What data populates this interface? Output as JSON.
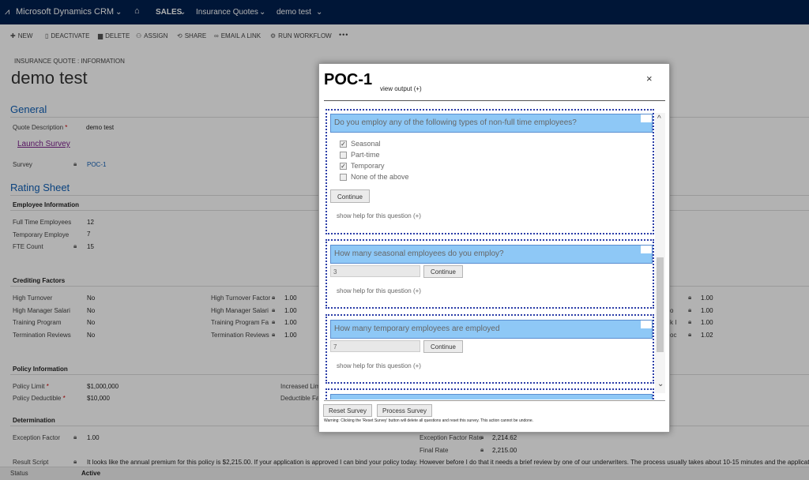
{
  "topnav": {
    "app_title": "Microsoft Dynamics CRM",
    "area": "SALES",
    "entity": "Insurance Quotes",
    "record": "demo test"
  },
  "commands": {
    "new": "NEW",
    "deactivate": "DEACTIVATE",
    "delete": "DELETE",
    "assign": "ASSIGN",
    "share": "SHARE",
    "email_link": "EMAIL A LINK",
    "run_workflow": "RUN WORKFLOW",
    "more": "•••"
  },
  "form": {
    "entity_label": "INSURANCE QUOTE : INFORMATION",
    "record_title": "demo test",
    "general": {
      "heading": "General",
      "quote_desc_label": "Quote Description",
      "quote_desc_required": "*",
      "quote_desc_value": "demo test",
      "launch_survey": "Launch Survey",
      "survey_label": "Survey",
      "survey_value": "POC-1"
    },
    "rating": {
      "heading": "Rating Sheet",
      "employee_info": "Employee Information",
      "fte_label": "Full Time Employees",
      "fte_value": "12",
      "temp_label": "Temporary Employe",
      "temp_value": "7",
      "fte_count_label": "FTE Count",
      "fte_count_value": "15"
    },
    "crediting": {
      "heading": "Crediting Factors",
      "left": [
        {
          "label": "High Turnover",
          "value": "No"
        },
        {
          "label": "High Manager Salari",
          "value": "No"
        },
        {
          "label": "Training Program",
          "value": "No"
        },
        {
          "label": "Termination Reviews",
          "value": "No"
        }
      ],
      "mid": [
        {
          "label": "High Turnover Factor",
          "value": "1.00"
        },
        {
          "label": "High Manager Salari",
          "value": "1.00"
        },
        {
          "label": "Training Program Fa",
          "value": "1.00"
        },
        {
          "label": "Termination Reviews",
          "value": "1.00"
        }
      ],
      "right_labels": [
        "",
        "o",
        "k I",
        "oc"
      ],
      "right": [
        "1.00",
        "1.00",
        "1.00",
        "1.02"
      ]
    },
    "policy": {
      "heading": "Policy Information",
      "limit_label": "Policy Limit",
      "limit_required": "*",
      "limit_value": "$1,000,000",
      "deductible_label": "Policy Deductible",
      "deductible_required": "*",
      "deductible_value": "$10,000",
      "increased_label": "Increased Lim",
      "deductible_fa_label": "Deductible Fa"
    },
    "determination": {
      "heading": "Determination",
      "exception_label": "Exception Factor",
      "exception_value": "1.00",
      "exception_rate_label": "Exception Factor Rate",
      "exception_rate_value": "2,214.62",
      "final_rate_label": "Final Rate",
      "final_rate_value": "2,215.00",
      "result_label": "Result Script",
      "result_text": "It looks like the annual premium for this policy is $2,215.00. If your application is approved I can bind your policy today. However before I do that it needs a brief review by one of our underwriters. The process usually takes about 10-15 minutes and the application is"
    }
  },
  "status": {
    "label": "Status",
    "value": "Active"
  },
  "dialog": {
    "title": "POC-1",
    "view_output": "view output (+)",
    "close": "×",
    "q1": {
      "question": "Do you employ any of the following types of non-full time employees?",
      "options": [
        {
          "label": "Seasonal",
          "checked": true
        },
        {
          "label": "Part-time",
          "checked": false
        },
        {
          "label": "Temporary",
          "checked": true
        },
        {
          "label": "None of the above",
          "checked": false
        }
      ],
      "continue": "Continue",
      "help": "show help for this question (+)"
    },
    "q2": {
      "question": "How many seasonal employees do you employ?",
      "value": "3",
      "continue": "Continue",
      "help": "show help for this question (+)"
    },
    "q3": {
      "question": "How many temporary employees are employed",
      "value": "7",
      "continue": "Continue",
      "help": "show help for this question (+)"
    },
    "reset": "Reset Survey",
    "process": "Process Survey",
    "warning": "Warning: Clicking the 'Reset Survey' button will delete all questions and reset this survey. This action cannot be undone."
  }
}
